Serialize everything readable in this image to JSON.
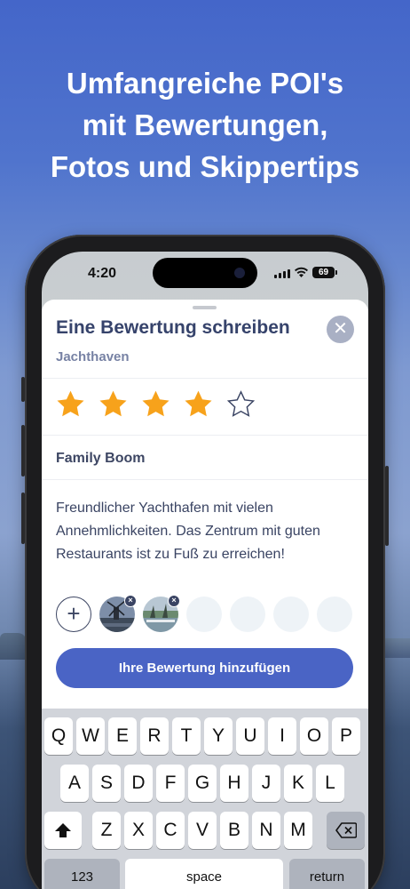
{
  "headline": {
    "line1": "Umfangreiche POI's",
    "line2": "mit Bewertungen,",
    "line3": "Fotos und Skippertips"
  },
  "status_bar": {
    "time": "4:20",
    "battery": "69"
  },
  "review_sheet": {
    "title": "Eine Bewertung schreiben",
    "subtitle": "Jachthaven",
    "close_icon": "close-icon",
    "rating": 4,
    "rating_max": 5,
    "review_title": "Family Boom",
    "review_text": "Freundlicher Yachthafen mit vielen Annehmlichkeiten. Das Zentrum mit guten Restaurants ist zu Fuß zu erreichen!",
    "add_photo_label": "+",
    "photo_count": 2,
    "empty_photo_slots": 4,
    "submit_label": "Ihre Bewertung hinzufügen",
    "accent_color": "#4a64c5",
    "star_color": "#f7a21b"
  },
  "keyboard": {
    "row1": [
      "Q",
      "W",
      "E",
      "R",
      "T",
      "Y",
      "U",
      "I",
      "O",
      "P"
    ],
    "row2": [
      "A",
      "S",
      "D",
      "F",
      "G",
      "H",
      "J",
      "K",
      "L"
    ],
    "row3": [
      "Z",
      "X",
      "C",
      "V",
      "B",
      "N",
      "M"
    ],
    "numbers_key": "123",
    "space_key": "space",
    "return_key": "return",
    "shift_icon": "shift-icon",
    "delete_icon": "backspace-icon"
  }
}
